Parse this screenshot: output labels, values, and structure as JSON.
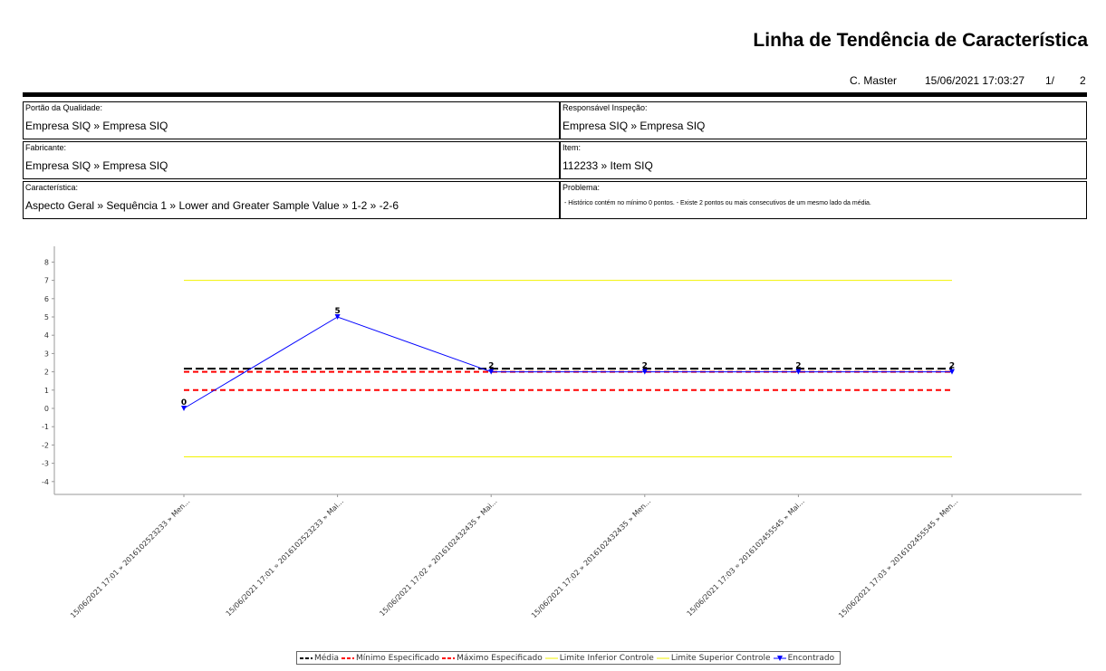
{
  "header": {
    "title": "Linha de Tendência de Característica",
    "user": "C. Master",
    "datetime": "15/06/2021 17:03:27",
    "page": "1/",
    "pages": "2"
  },
  "info": {
    "portao_label": "Portão da Qualidade:",
    "portao_value": "Empresa SIQ » Empresa SIQ",
    "responsavel_label": "Responsável Inspeção:",
    "responsavel_value": "Empresa SIQ » Empresa SIQ",
    "fabricante_label": "Fabricante:",
    "fabricante_value": "Empresa SIQ » Empresa SIQ",
    "item_label": "Item:",
    "item_value": "112233 » Item SIQ",
    "caracteristica_label": "Característica:",
    "caracteristica_value": "Aspecto Geral » Sequência 1 » Lower and Greater Sample Value » 1-2 » -2-6",
    "problema_label": "Problema:",
    "problema_value": " - Histórico contém no mínimo 0 pontos. - Existe 2 pontos ou mais consecutivos de um mesmo lado da média."
  },
  "chart_data": {
    "type": "line",
    "categories": [
      "15/06/2021 17:01 » 2016102523233 » Men...",
      "15/06/2021 17:01 » 2016102523233 » Mai...",
      "15/06/2021 17:02 » 2016102432435 » Mai...",
      "15/06/2021 17:02 » 2016102432435 » Men...",
      "15/06/2021 17:03 » 2016102455545 » Mai...",
      "15/06/2021 17:03 » 2016102455545 » Men..."
    ],
    "ylim": [
      -4.5,
      9
    ],
    "yticks": [
      -4,
      -3,
      -2,
      -1,
      0,
      1,
      2,
      3,
      4,
      5,
      6,
      7,
      8
    ],
    "series": [
      {
        "name": "Média",
        "values": [
          2.17,
          2.17,
          2.17,
          2.17,
          2.17,
          2.17
        ],
        "color": "#000000",
        "style": "dashed"
      },
      {
        "name": "Mínimo Especificado",
        "values": [
          1,
          1,
          1,
          1,
          1,
          1
        ],
        "color": "#ff0000",
        "style": "dashed"
      },
      {
        "name": "Máximo Especificado",
        "values": [
          2,
          2,
          2,
          2,
          2,
          2
        ],
        "color": "#ff0000",
        "style": "dashed"
      },
      {
        "name": "Limite Inferior Controle",
        "values": [
          -2.65,
          -2.65,
          -2.65,
          -2.65,
          -2.65,
          -2.65
        ],
        "color": "#f2f200",
        "style": "solid"
      },
      {
        "name": "Limite Superior Controle",
        "values": [
          7,
          7,
          7,
          7,
          7,
          7
        ],
        "color": "#f2f200",
        "style": "solid"
      },
      {
        "name": "Encontrado",
        "values": [
          0,
          5,
          2,
          2,
          2,
          2
        ],
        "labels": [
          "0",
          "5",
          "2",
          "2",
          "2",
          "2"
        ],
        "color": "#0000ff",
        "style": "solid-marker"
      }
    ]
  }
}
